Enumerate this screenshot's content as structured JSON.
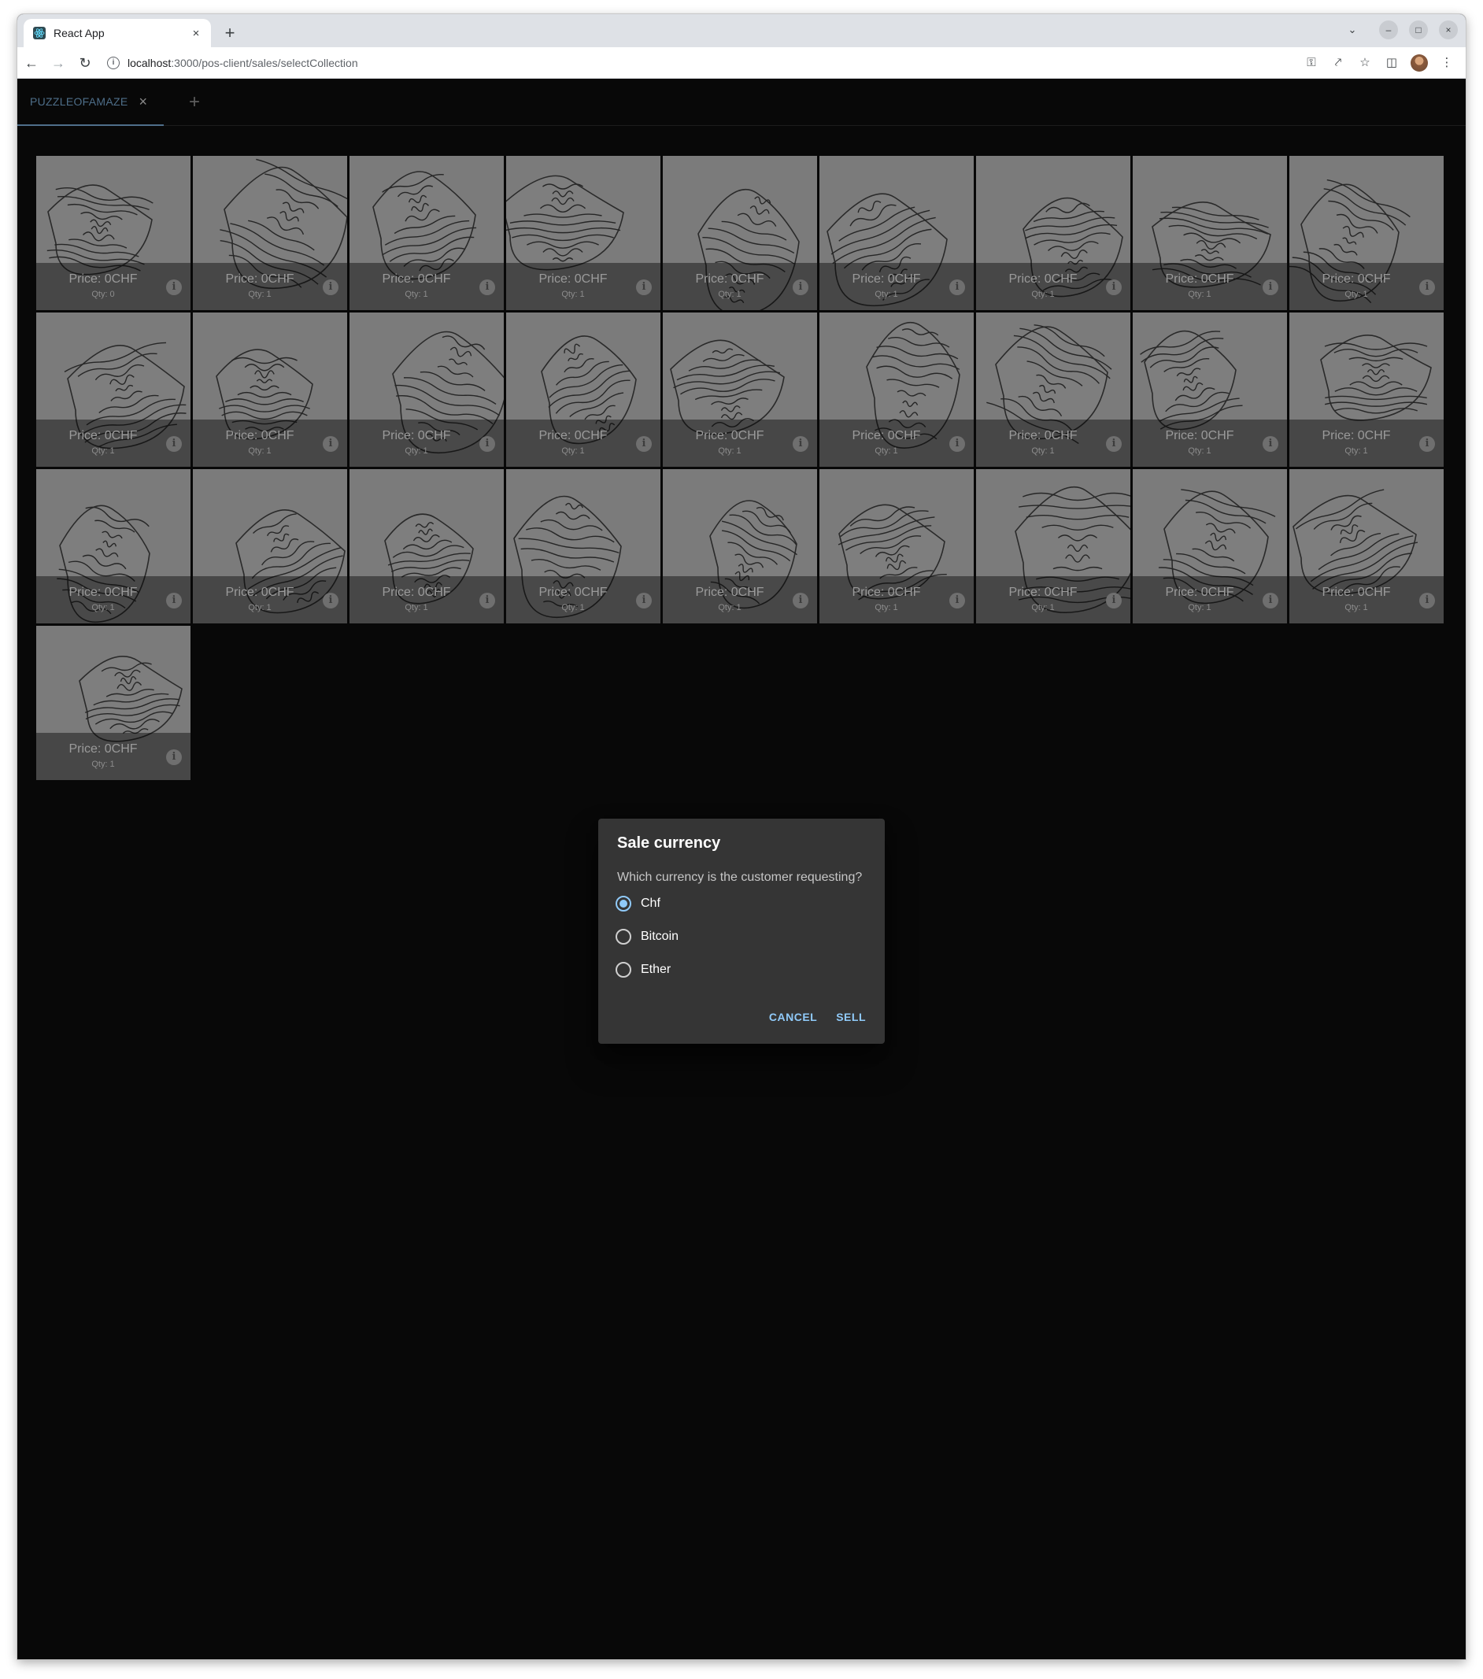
{
  "browser": {
    "tab_title": "React App",
    "tab_close": "×",
    "new_tab": "+",
    "url_host": "localhost",
    "url_rest": ":3000/pos-client/sales/selectCollection",
    "window_controls": [
      "–",
      "□",
      "×"
    ]
  },
  "app": {
    "collection_tab_label": "PUZZLEOFAMAZE",
    "collection_tab_close": "×",
    "add_tab": "+"
  },
  "items": [
    {
      "price": "Price: 0CHF",
      "qty": "Qty: 0"
    },
    {
      "price": "Price: 0CHF",
      "qty": "Qty: 1"
    },
    {
      "price": "Price: 0CHF",
      "qty": "Qty: 1"
    },
    {
      "price": "Price: 0CHF",
      "qty": "Qty: 1"
    },
    {
      "price": "Price: 0CHF",
      "qty": "Qty: 1"
    },
    {
      "price": "Price: 0CHF",
      "qty": "Qty: 1"
    },
    {
      "price": "Price: 0CHF",
      "qty": "Qty: 1"
    },
    {
      "price": "Price: 0CHF",
      "qty": "Qty: 1"
    },
    {
      "price": "Price: 0CHF",
      "qty": "Qty: 1"
    },
    {
      "price": "Price: 0CHF",
      "qty": "Qty: 1"
    },
    {
      "price": "Price: 0CHF",
      "qty": "Qty: 1"
    },
    {
      "price": "Price: 0CHF",
      "qty": "Qty: 1"
    },
    {
      "price": "Price: 0CHF",
      "qty": "Qty: 1"
    },
    {
      "price": "Price: 0CHF",
      "qty": "Qty: 1"
    },
    {
      "price": "Price: 0CHF",
      "qty": "Qty: 1"
    },
    {
      "price": "Price: 0CHF",
      "qty": "Qty: 1"
    },
    {
      "price": "Price: 0CHF",
      "qty": "Qty: 1"
    },
    {
      "price": "Price: 0CHF",
      "qty": "Qty: 1"
    },
    {
      "price": "Price: 0CHF",
      "qty": "Qty: 1"
    },
    {
      "price": "Price: 0CHF",
      "qty": "Qty: 1"
    },
    {
      "price": "Price: 0CHF",
      "qty": "Qty: 1"
    },
    {
      "price": "Price: 0CHF",
      "qty": "Qty: 1"
    },
    {
      "price": "Price: 0CHF",
      "qty": "Qty: 1"
    },
    {
      "price": "Price: 0CHF",
      "qty": "Qty: 1"
    },
    {
      "price": "Price: 0CHF",
      "qty": "Qty: 1"
    },
    {
      "price": "Price: 0CHF",
      "qty": "Qty: 1"
    },
    {
      "price": "Price: 0CHF",
      "qty": "Qty: 1"
    },
    {
      "price": "Price: 0CHF",
      "qty": "Qty: 1"
    }
  ],
  "dialog": {
    "title": "Sale currency",
    "question": "Which currency is the customer requesting?",
    "options": [
      {
        "label": "Chf",
        "selected": true
      },
      {
        "label": "Bitcoin",
        "selected": false
      },
      {
        "label": "Ether",
        "selected": false
      }
    ],
    "cancel_label": "CANCEL",
    "sell_label": "SELL"
  },
  "colors": {
    "accent": "#90caf9",
    "tab_accent": "#4e6e89",
    "dialog_bg": "#353535",
    "page_bg": "#080808"
  },
  "icons": {
    "info": "info-icon",
    "tab_close": "close-icon",
    "add_tab": "plus-icon"
  }
}
